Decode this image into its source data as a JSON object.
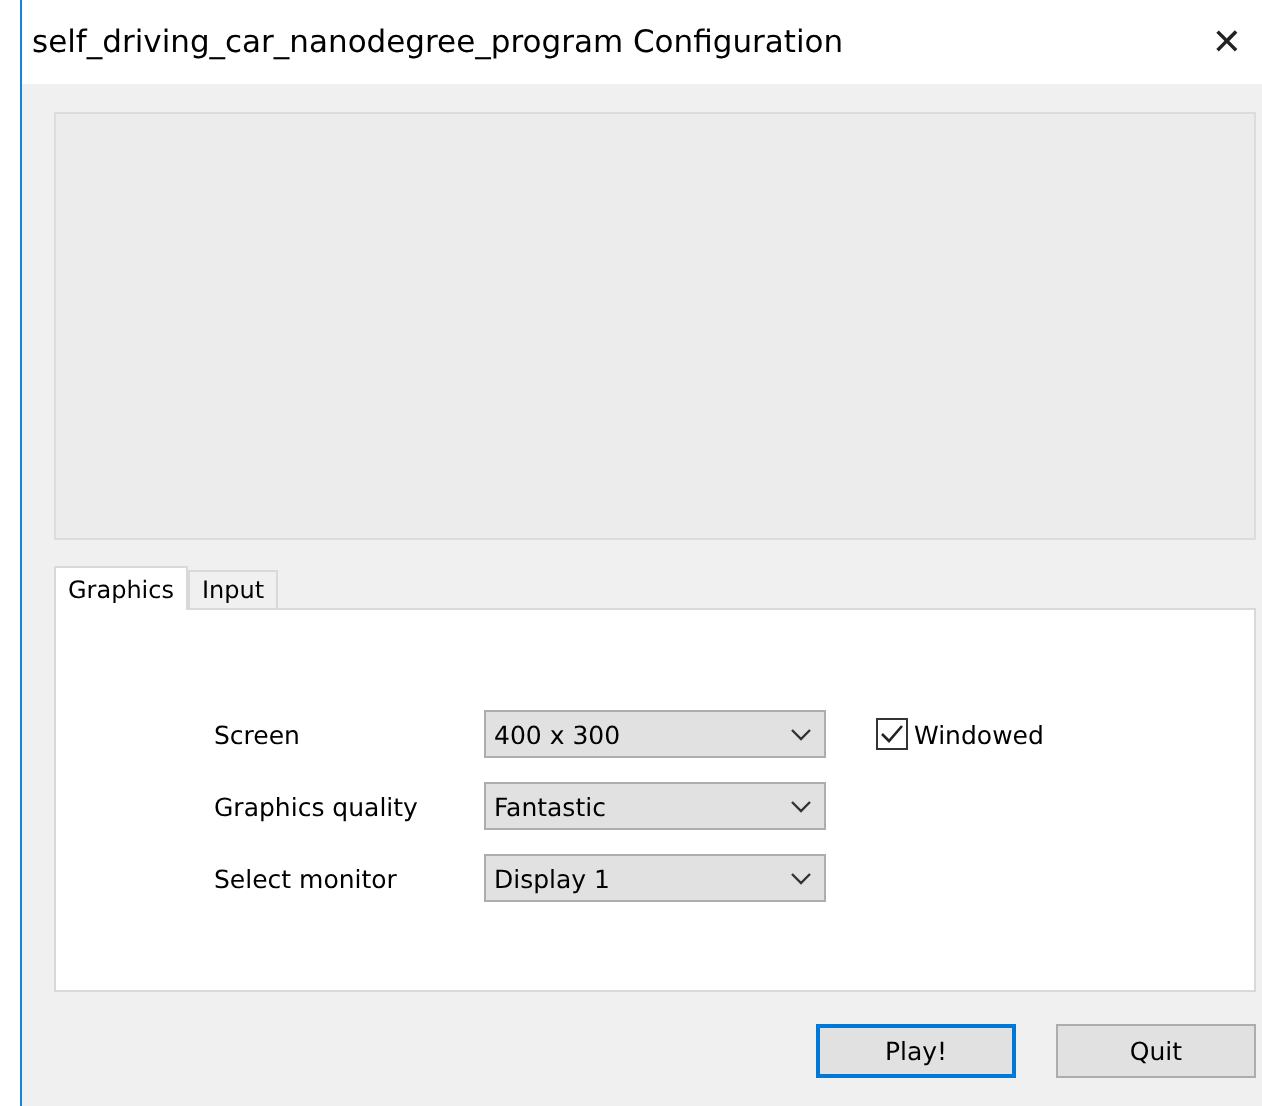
{
  "window": {
    "title": "self_driving_car_nanodegree_program Configuration",
    "close": "✕"
  },
  "tabs": [
    {
      "label": "Graphics",
      "selected": true
    },
    {
      "label": "Input",
      "selected": false
    }
  ],
  "settings": [
    {
      "label": "Screen",
      "value": "400 x 300",
      "option": {
        "label": "Windowed",
        "checked": true
      }
    },
    {
      "label": "Graphics quality",
      "value": "Fantastic"
    },
    {
      "label": "Select monitor",
      "value": "Display 1"
    }
  ],
  "buttons": [
    {
      "label": "Play!",
      "default": true
    },
    {
      "label": "Quit",
      "default": false
    }
  ]
}
